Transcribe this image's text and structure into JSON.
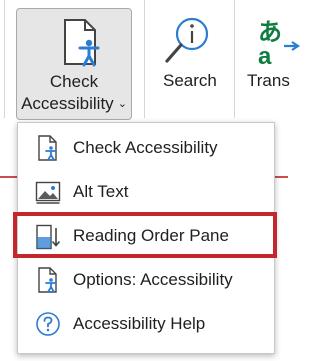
{
  "ribbon": {
    "check_accessibility": {
      "line1": "Check",
      "line2": "Accessibility",
      "chevron": "⌄"
    },
    "search": {
      "label": "Search"
    },
    "translate": {
      "label": "Trans"
    }
  },
  "menu": {
    "items": [
      {
        "label": "Check Accessibility",
        "icon": "accessibility-doc-icon"
      },
      {
        "label": "Alt Text",
        "icon": "alt-text-image-icon"
      },
      {
        "label": "Reading Order Pane",
        "icon": "reading-order-icon",
        "highlighted": true
      },
      {
        "label": "Options: Accessibility",
        "icon": "accessibility-options-icon"
      },
      {
        "label": "Accessibility Help",
        "icon": "help-circle-icon"
      }
    ]
  },
  "colors": {
    "accent_blue": "#2b7cd3",
    "highlight_red": "#c4262e",
    "translate_green": "#107c41"
  }
}
